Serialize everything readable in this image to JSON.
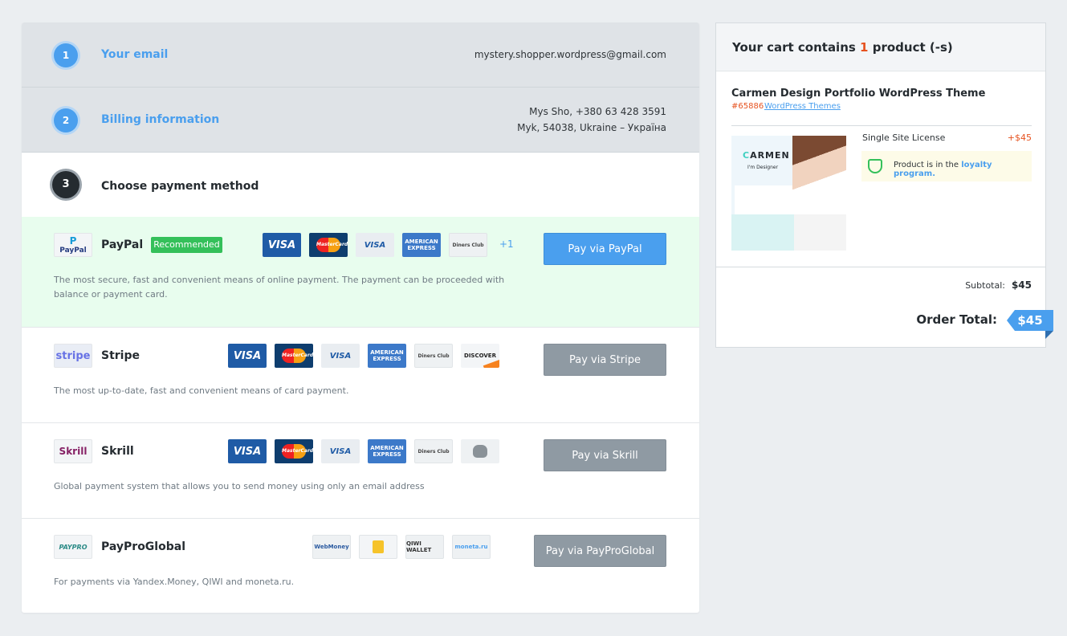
{
  "steps": {
    "email": {
      "num": "1",
      "title": "Your email",
      "value": "mystery.shopper.wordpress@gmail.com"
    },
    "billing": {
      "num": "2",
      "title": "Billing information",
      "line1": "Mys Sho, +380 63 428 3591",
      "line2": "Myk, 54038, Ukraine – Україна"
    },
    "payment": {
      "num": "3",
      "title": "Choose payment method"
    }
  },
  "methods": {
    "paypal": {
      "logo": "PayPal",
      "name": "PayPal",
      "badge": "Recommended",
      "more": "+1",
      "desc": "The most secure, fast and convenient means of online payment. The payment can be proceeded with balance or payment card.",
      "button": "Pay via PayPal"
    },
    "stripe": {
      "logo": "stripe",
      "name": "Stripe",
      "desc": "The most up-to-date, fast and convenient means of card payment.",
      "button": "Pay via Stripe"
    },
    "skrill": {
      "logo": "Skrill",
      "name": "Skrill",
      "desc": "Global payment system that allows you to send money using only an email address",
      "button": "Pay via Skrill"
    },
    "payproglobal": {
      "logo": "PAYPRO",
      "name": "PayProGlobal",
      "desc": "For payments via Yandex.Money, QIWI and moneta.ru.",
      "button": "Pay via PayProGlobal"
    }
  },
  "cards": {
    "visa": "VISA",
    "mastercard": "MasterCard",
    "visa_electron": "VISA",
    "amex": "AMERICAN EXPRESS",
    "diners": "Diners Club",
    "discover": "DISCOVER",
    "webmoney": "WebMoney",
    "qiwi": "QIWI WALLET",
    "moneta": "moneta.ru"
  },
  "cart": {
    "head_prefix": "Your cart contains",
    "count": "1",
    "head_suffix": "product (-s)",
    "product_title": "Carmen Design Portfolio WordPress Theme",
    "product_id": "#65886",
    "product_category": "WordPress Themes",
    "thumb_logo": "ARMEN",
    "thumb_logo_c": "C",
    "thumb_sub": "I'm Designer",
    "license": "Single Site License",
    "license_price": "+$45",
    "loyalty_text": "Product is in the",
    "loyalty_link": "loyalty program.",
    "subtotal_label": "Subtotal:",
    "subtotal_value": "$45",
    "total_label": "Order Total:",
    "total_value": "$45"
  },
  "colors": {
    "accent": "#4a9fee",
    "recommended": "#34c05a",
    "price": "#e6521f",
    "paypal_bg": "#e8fdee"
  }
}
